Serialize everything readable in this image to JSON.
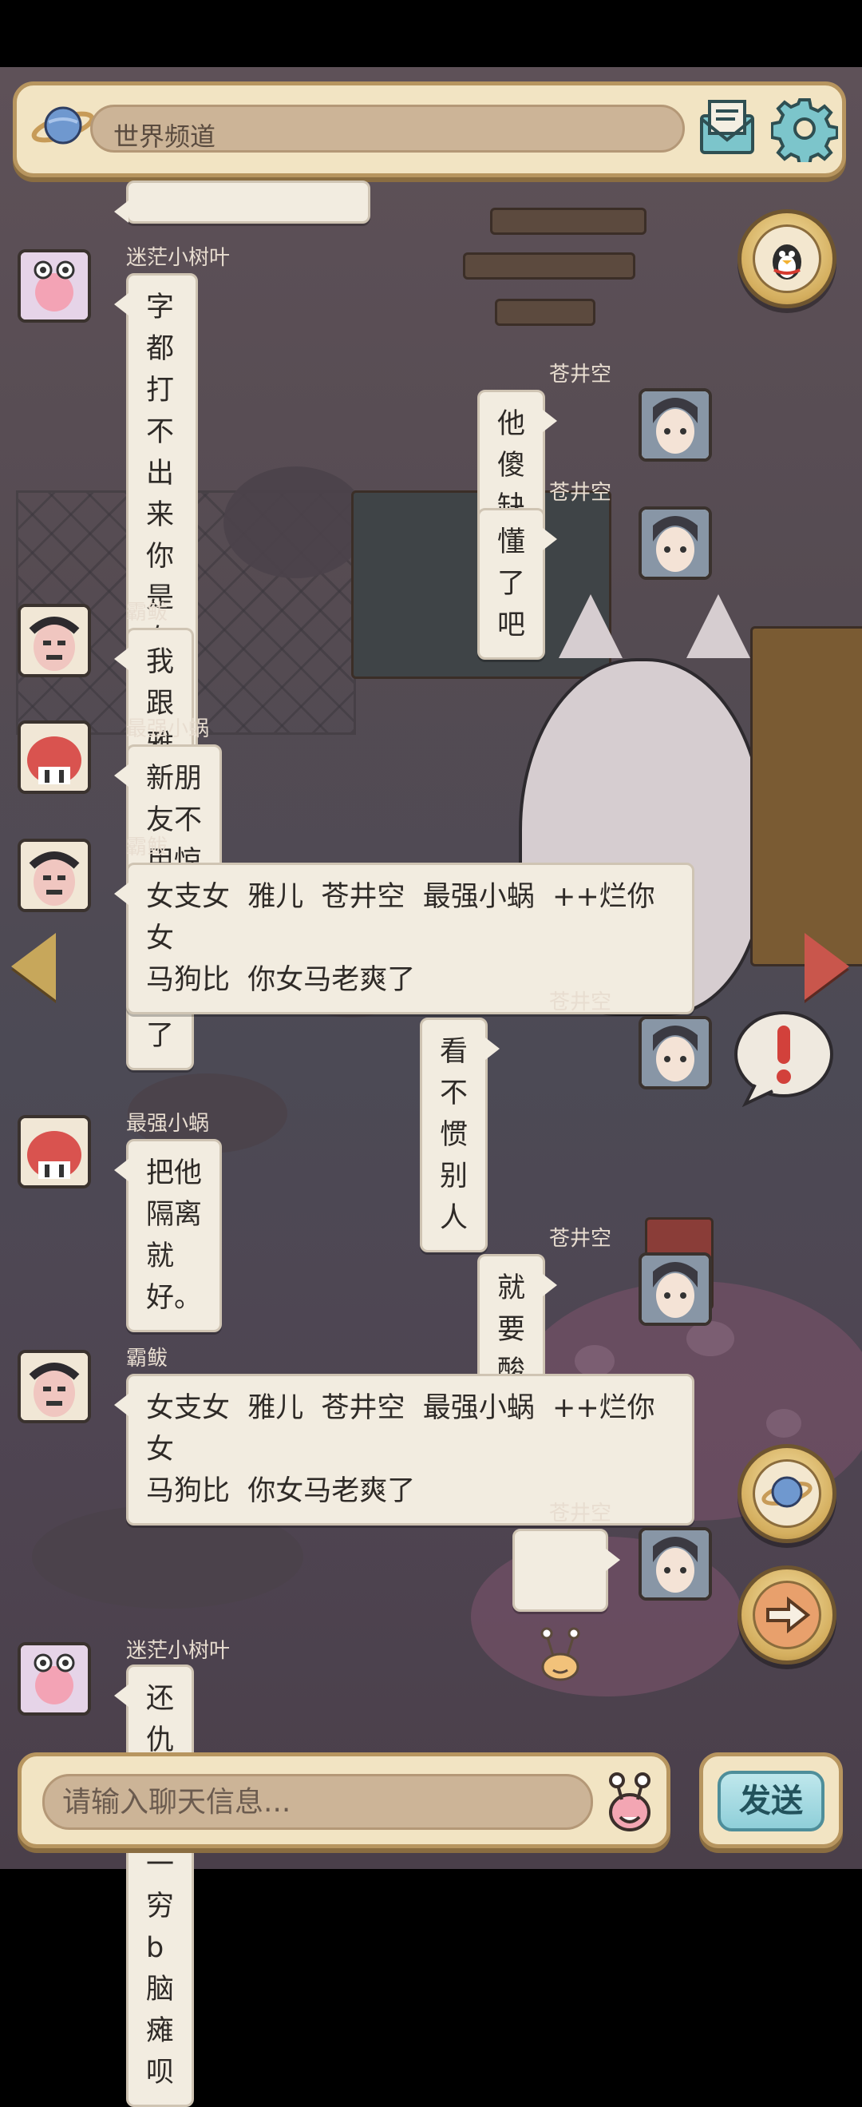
{
  "header": {
    "channel_title": "世界频道"
  },
  "input": {
    "placeholder": "请输入聊天信息..."
  },
  "send_label": "发送",
  "messages": [
    {
      "user": "迷茫小树叶",
      "text": "字都打不出来你是有多fw啊"
    },
    {
      "user": "苍井空",
      "text": "他傻缺"
    },
    {
      "user": "苍井空",
      "text": "懂了吧"
    },
    {
      "user": "霸鲅",
      "text": "我跟雅儿仇恨好几天了"
    },
    {
      "user": "最强小蜗",
      "text": "新朋友不用惊讶。"
    },
    {
      "user": "霸鲅",
      "text": "女支女  雅儿  苍井空  最强小蜗  ++烂你女\n马狗比  你女马老爽了"
    },
    {
      "user": "苍井空",
      "text": "看不惯别人"
    },
    {
      "user": "最强小蜗",
      "text": "把他隔离就好。"
    },
    {
      "user": "苍井空",
      "text": "就要酸"
    },
    {
      "user": "霸鲅",
      "text": "女支女  雅儿  苍井空  最强小蜗  ++烂你女\n马狗比  你女马老爽了"
    },
    {
      "user": "苍井空",
      "text": ""
    },
    {
      "user": "迷茫小树叶",
      "text": "还仇恨  就一穷  b脑瘫呗"
    }
  ],
  "colors": {
    "frame": "#f2e4c3",
    "frame_border": "#b7955f",
    "bubble": "#f2ece0",
    "username": "#e8ddd0"
  }
}
